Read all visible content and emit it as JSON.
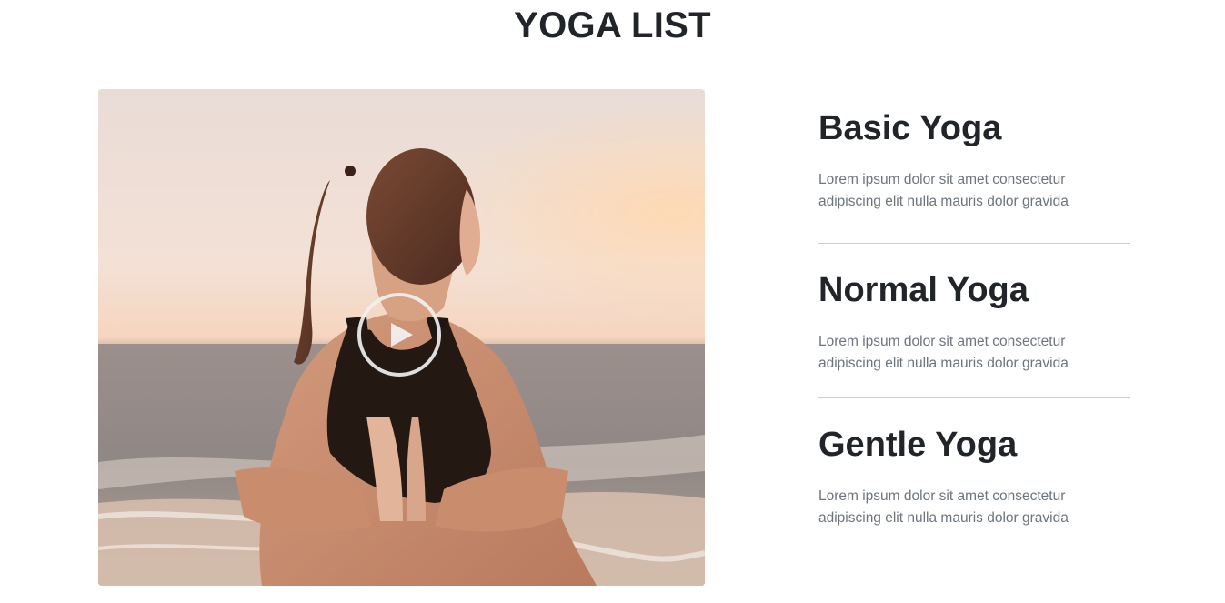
{
  "section": {
    "title": "YOGA LIST"
  },
  "video": {
    "image_icon": "woman-yoga-beach-photo",
    "play_icon": "play-icon"
  },
  "items": [
    {
      "title": "Basic Yoga",
      "description": "Lorem ipsum dolor sit amet consectetur adipiscing elit nulla mauris dolor gravida"
    },
    {
      "title": "Normal Yoga",
      "description": "Lorem ipsum dolor sit amet consectetur adipiscing elit nulla mauris dolor gravida"
    },
    {
      "title": "Gentle Yoga",
      "description": "Lorem ipsum dolor sit amet consectetur adipiscing elit nulla mauris dolor gravida"
    }
  ],
  "colors": {
    "heading": "#212529",
    "body_text": "#6c757d",
    "divider": "#c9cdd1"
  }
}
